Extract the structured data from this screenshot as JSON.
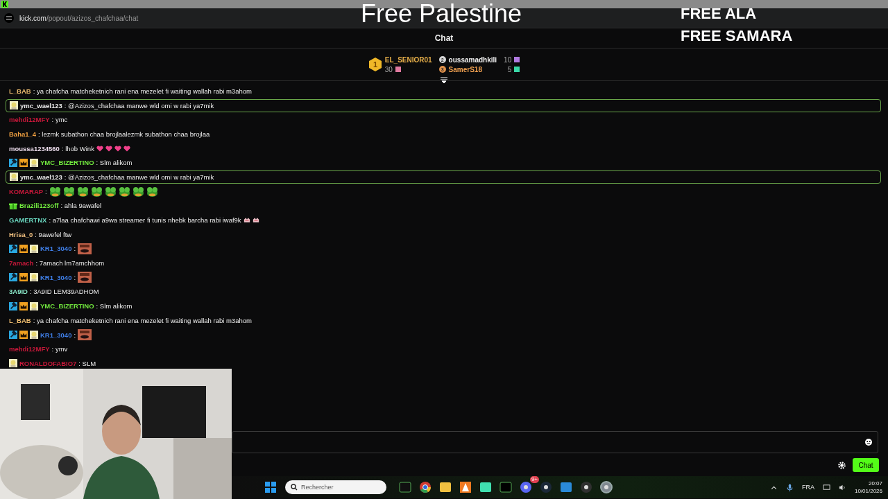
{
  "browser": {
    "url_host": "kick.com",
    "url_path": "/popout/azizos_chafchaa/chat"
  },
  "overlay": {
    "headline": "Free Palestine",
    "lines": [
      "FREE ALA",
      "FREE SAMARA"
    ]
  },
  "chat": {
    "title": "Chat",
    "leaderboard": [
      {
        "rank": "1",
        "name": "EL_SENIOR01",
        "count": "30",
        "color": "#e8b04a",
        "gift": {
          "color": "#e07aa0"
        }
      },
      {
        "rank": "2",
        "name": "oussamadhkili",
        "count": "10",
        "color": "#f2f2f2",
        "gift": {
          "color": "#b07ae0"
        }
      },
      {
        "rank": "3",
        "name": "SamerS18",
        "count": "5",
        "color": "#f0a050",
        "gift": {
          "color": "#3ad8a8"
        }
      }
    ],
    "messages": [
      {
        "user": "L_BAB",
        "color": "#e8b86d",
        "text": ": ya chafcha matcheketnich rani ena mezelet fi waiting wallah rabi m3ahom",
        "highlighted": false
      },
      {
        "user": "ymc_wael123",
        "color": "#e8e8e8",
        "badges": [
          {
            "kind": "avatar"
          }
        ],
        "text": ": @Azizos_chafchaa manwe wld omi w rabi ya7mik",
        "highlighted": true
      },
      {
        "user": "mehdi12MFY",
        "color": "#c8183a",
        "text": ": ymc",
        "highlighted": false
      },
      {
        "user": "Baha1_4",
        "color": "#f0a040",
        "text": ": lezmk subathon chaa brojlaalezmk subathon chaa brojlaa",
        "highlighted": false
      },
      {
        "user": "moussa1234560",
        "color": "#ecdcec",
        "text": ": lhob Wink",
        "emotes": [
          {
            "kind": "heart"
          },
          {
            "kind": "heart"
          },
          {
            "kind": "heart"
          },
          {
            "kind": "heart"
          }
        ],
        "highlighted": false
      },
      {
        "user": "YMC_BIZERTINO",
        "color": "#72e83e",
        "badges": [
          {
            "kind": "mod"
          },
          {
            "kind": "crown"
          },
          {
            "kind": "avatar"
          }
        ],
        "text": ": Slm alikom",
        "highlighted": false
      },
      {
        "user": "ymc_wael123",
        "color": "#e8e8e8",
        "badges": [
          {
            "kind": "avatar"
          }
        ],
        "text": ": @Azizos_chafchaa manwe wld omi w rabi ya7mik",
        "highlighted": true
      },
      {
        "user": "KOMARAP",
        "color": "#c8183a",
        "text": ":",
        "emotes": [
          {
            "kind": "frog"
          },
          {
            "kind": "frog"
          },
          {
            "kind": "frog"
          },
          {
            "kind": "frog"
          },
          {
            "kind": "frog"
          },
          {
            "kind": "frog"
          },
          {
            "kind": "frog"
          },
          {
            "kind": "frog"
          }
        ],
        "highlighted": false
      },
      {
        "user": "Brazili123off",
        "color": "#72e83e",
        "badges": [
          {
            "kind": "gift"
          }
        ],
        "text": ": ahla 9awafel",
        "highlighted": false
      },
      {
        "user": "GAMERTNX",
        "color": "#6ad8c0",
        "text": ": a7laa chafchawi a9wa streamer fi tunis nhebk barcha rabi iwaf9k",
        "emotes": [
          {
            "kind": "hands"
          },
          {
            "kind": "hands"
          }
        ],
        "highlighted": false
      },
      {
        "user": "Hrisa_0",
        "color": "#f0c080",
        "text": ": 9awefel ftw",
        "highlighted": false
      },
      {
        "user": "KR1_3040",
        "color": "#3f7fe8",
        "badges": [
          {
            "kind": "mod"
          },
          {
            "kind": "crown"
          },
          {
            "kind": "avatar"
          }
        ],
        "text": ":",
        "emotes": [
          {
            "kind": "face"
          }
        ],
        "highlighted": false
      },
      {
        "user": "7amach",
        "color": "#c8183a",
        "text": ": 7amach lm7amchhom",
        "highlighted": false
      },
      {
        "user": "KR1_3040",
        "color": "#3f7fe8",
        "badges": [
          {
            "kind": "mod"
          },
          {
            "kind": "crown"
          },
          {
            "kind": "avatar"
          }
        ],
        "text": ":",
        "emotes": [
          {
            "kind": "face"
          }
        ],
        "highlighted": false
      },
      {
        "user": "3A9ID",
        "color": "#8ae8c8",
        "text": ": 3A9ID LEM39ADHOM",
        "highlighted": false
      },
      {
        "user": "YMC_BIZERTINO",
        "color": "#72e83e",
        "badges": [
          {
            "kind": "mod"
          },
          {
            "kind": "crown"
          },
          {
            "kind": "avatar"
          }
        ],
        "text": ": Slm alikom",
        "highlighted": false
      },
      {
        "user": "L_BAB",
        "color": "#e8b86d",
        "text": ": ya chafcha matcheketnich rani ena mezelet fi waiting wallah rabi m3ahom",
        "highlighted": false
      },
      {
        "user": "KR1_3040",
        "color": "#3f7fe8",
        "badges": [
          {
            "kind": "mod"
          },
          {
            "kind": "crown"
          },
          {
            "kind": "avatar"
          }
        ],
        "text": ":",
        "emotes": [
          {
            "kind": "face"
          }
        ],
        "highlighted": false
      },
      {
        "user": "mehdi12MFY",
        "color": "#c8183a",
        "text": ": ymv",
        "highlighted": false
      },
      {
        "user": "RONALDOFABIO7",
        "color": "#c8183a",
        "badges": [
          {
            "kind": "avatar"
          }
        ],
        "text": ": SLM",
        "highlighted": false
      }
    ],
    "send_button": "Chat"
  },
  "taskbar": {
    "search_placeholder": "Rechercher",
    "apps": [
      {
        "kind": "start"
      },
      {
        "kind": "game"
      },
      {
        "kind": "browser"
      },
      {
        "kind": "folder"
      },
      {
        "kind": "cone"
      },
      {
        "kind": "messenger"
      },
      {
        "kind": "terminal"
      },
      {
        "kind": "discord",
        "badge": "9+"
      },
      {
        "kind": "steam"
      },
      {
        "kind": "photos"
      },
      {
        "kind": "record"
      },
      {
        "kind": "settings"
      }
    ],
    "language": "FRA",
    "time": "20:07",
    "date": "10/01/2026"
  }
}
